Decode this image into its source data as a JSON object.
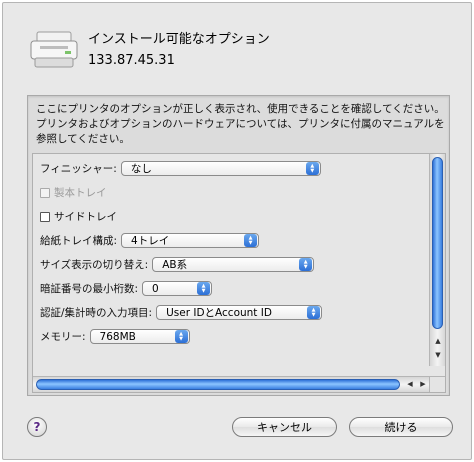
{
  "header": {
    "title": "インストール可能なオプション",
    "ip": "133.87.45.31",
    "icon": "printer-icon"
  },
  "description": "ここにプリンタのオプションが正しく表示され、使用できることを確認してください。プリンタおよびオプションのハードウェアについては、プリンタに付属のマニュアルを参照してください。",
  "options": {
    "finisher": {
      "label": "フィニッシャー:",
      "value": "なし"
    },
    "booklet_tray": {
      "label": "製本トレイ",
      "checked": false,
      "enabled": false
    },
    "side_tray": {
      "label": "サイドトレイ",
      "checked": false,
      "enabled": true
    },
    "paper_tray_config": {
      "label": "給紙トレイ構成:",
      "value": "4トレイ"
    },
    "size_display_toggle": {
      "label": "サイズ表示の切り替え:",
      "value": "AB系"
    },
    "pin_min_digits": {
      "label": "暗証番号の最小桁数:",
      "value": "0"
    },
    "auth_input_item": {
      "label": "認証/集計時の入力項目:",
      "value": "User IDとAccount ID"
    },
    "memory": {
      "label": "メモリー:",
      "value": "768MB"
    }
  },
  "buttons": {
    "help": "?",
    "cancel": "キャンセル",
    "continue": "続ける"
  },
  "colors": {
    "accent": "#3a7fe0",
    "background": "#e8e8e8"
  }
}
